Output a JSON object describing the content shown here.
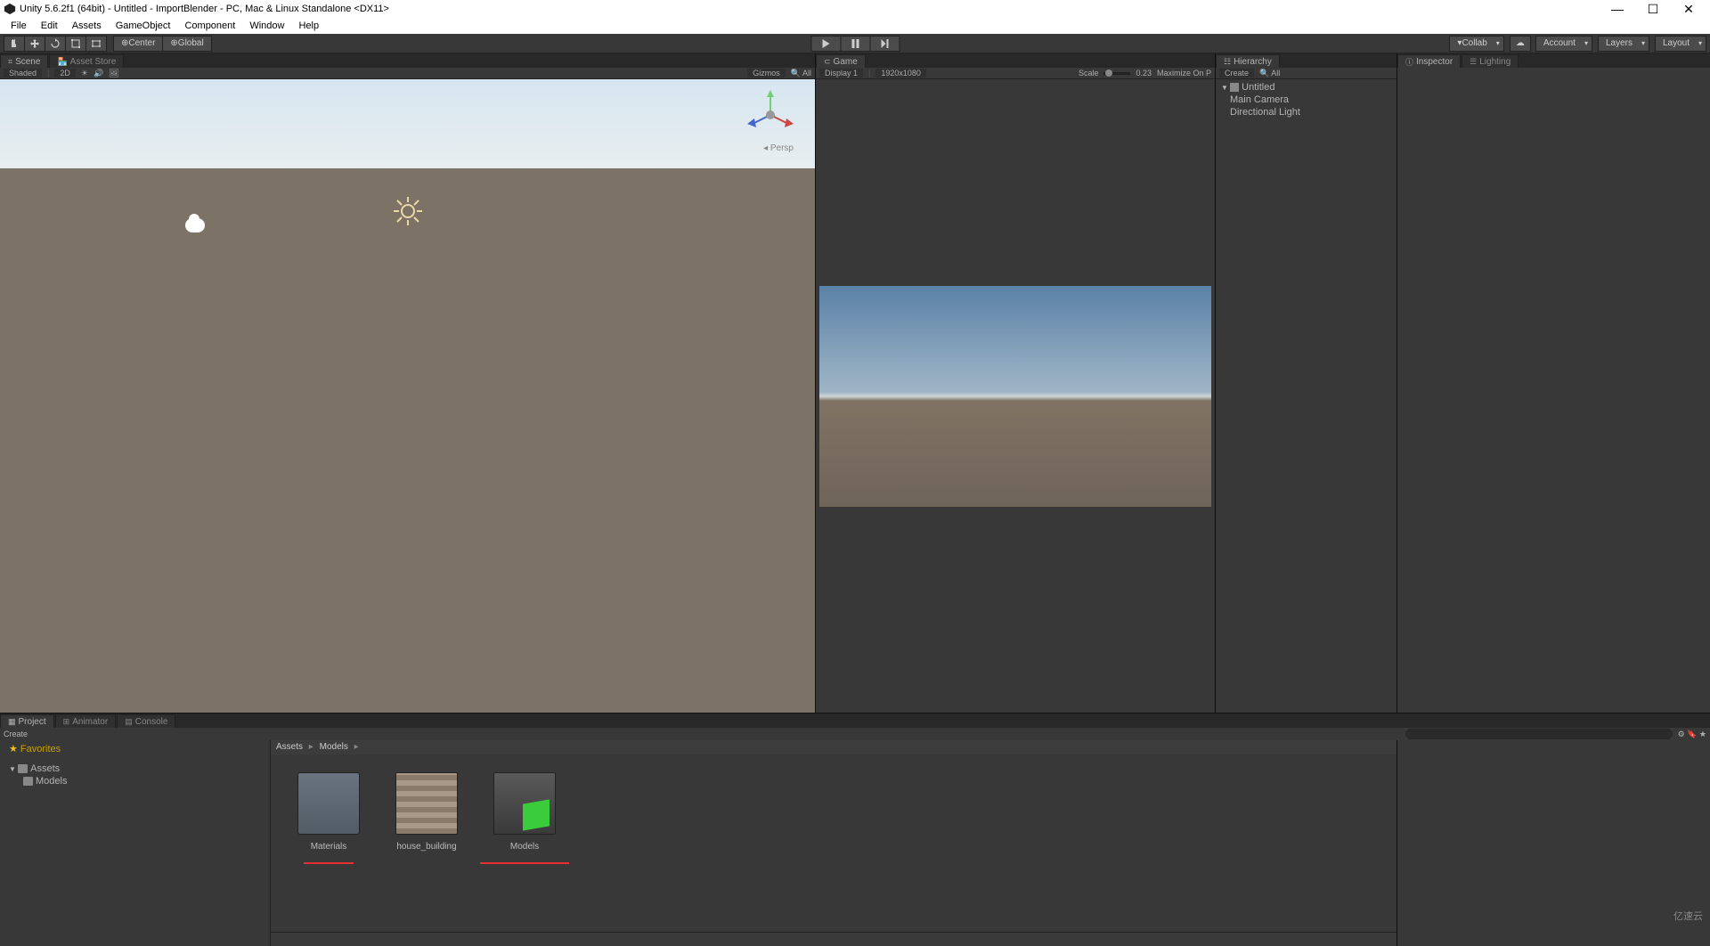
{
  "title": "Unity 5.6.2f1 (64bit) - Untitled - ImportBlender - PC, Mac & Linux Standalone <DX11>",
  "menu": [
    "File",
    "Edit",
    "Assets",
    "GameObject",
    "Component",
    "Window",
    "Help"
  ],
  "toolbar": {
    "pivot": "Center",
    "space": "Global",
    "collab": "Collab",
    "account": "Account",
    "layers": "Layers",
    "layout": "Layout"
  },
  "scene": {
    "tab": "Scene",
    "asset_store_tab": "Asset Store",
    "shading": "Shaded",
    "mode2d": "2D",
    "gizmos": "Gizmos",
    "search_placeholder": "All",
    "persp": "Persp"
  },
  "game": {
    "tab": "Game",
    "display": "Display 1",
    "resolution": "1920x1080",
    "scale_label": "Scale",
    "scale_value": "0.23",
    "maximize": "Maximize On P"
  },
  "hierarchy": {
    "tab": "Hierarchy",
    "create": "Create",
    "search_placeholder": "All",
    "root": "Untitled",
    "items": [
      "Main Camera",
      "Directional Light"
    ]
  },
  "inspector": {
    "tab": "Inspector",
    "lighting_tab": "Lighting"
  },
  "project": {
    "tab": "Project",
    "animator_tab": "Animator",
    "console_tab": "Console",
    "create": "Create",
    "favorites": "Favorites",
    "assets": "Assets",
    "models": "Models",
    "breadcrumb": [
      "Assets",
      "Models"
    ],
    "items": [
      {
        "name": "Materials",
        "type": "folder",
        "underline": true
      },
      {
        "name": "house_building",
        "type": "texture",
        "underline": false
      },
      {
        "name": "Models",
        "type": "model",
        "underline": true
      }
    ]
  },
  "watermark": "亿速云"
}
